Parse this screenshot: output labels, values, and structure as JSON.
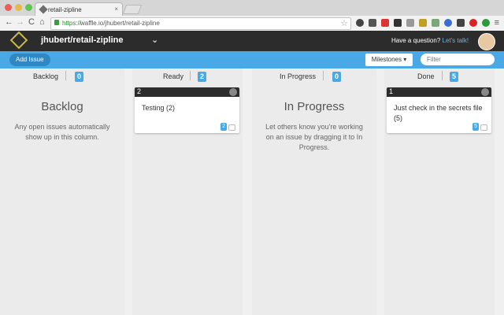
{
  "browser": {
    "tab_title": "retail-zipline",
    "tab_close": "×",
    "url_scheme": "https://",
    "url_rest": "waffle.io/jhubert/retail-zipline",
    "nav_back": "←",
    "nav_forward": "→",
    "nav_reload": "C",
    "nav_home": "⌂",
    "star": "☆",
    "menu": "≡"
  },
  "header": {
    "repo": "jhubert/retail-zipline",
    "repo_chevron": "⌄",
    "question": "Have a question? ",
    "talk_link": "Let's talk!"
  },
  "actions": {
    "add_issue": "Add Issue",
    "milestones": "Milestones ▾",
    "filter_placeholder": "Filter"
  },
  "columns": [
    {
      "name": "Backlog",
      "count": "0",
      "empty_title": "Backlog",
      "empty_text": "Any open issues automatically show up in this column."
    },
    {
      "name": "Ready",
      "count": "2"
    },
    {
      "name": "In Progress",
      "count": "0",
      "empty_title": "In Progress",
      "empty_text": "Let others know you're working on an issue by dragging it to In Progress."
    },
    {
      "name": "Done",
      "count": "5"
    }
  ],
  "cards": [
    {
      "number": "2",
      "title": "Testing (2)",
      "points": "2"
    },
    {
      "number": "1",
      "title": "Just check in the secrets file (5)",
      "points": "5"
    }
  ],
  "colors": {
    "accent": "#48a9e6",
    "header_bg": "#2c2c2c",
    "talk_link": "#58b8f0"
  }
}
